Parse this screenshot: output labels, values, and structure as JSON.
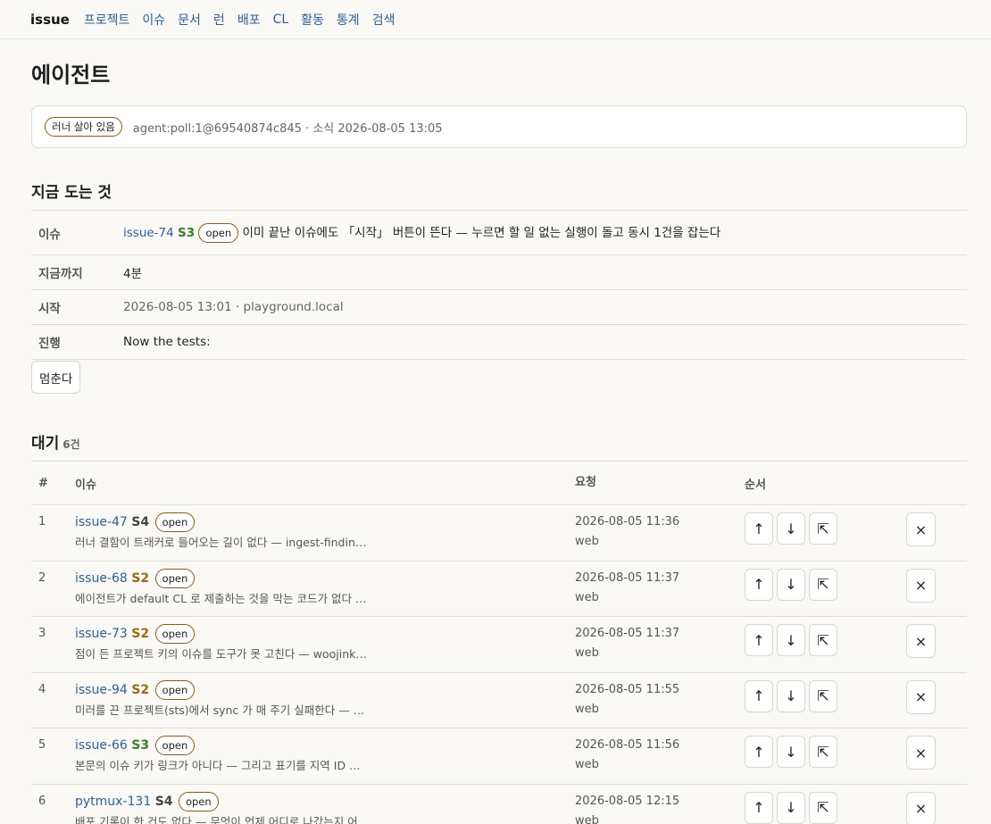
{
  "nav": {
    "brand": "issue",
    "links": [
      "프로젝트",
      "이슈",
      "문서",
      "런",
      "배포",
      "CL",
      "활동",
      "통계",
      "검색"
    ]
  },
  "page_title": "에이전트",
  "runner": {
    "badge": "러너 살아 있음",
    "meta": "agent:poll:1@69540874c845 · 소식 2026-08-05 13:05"
  },
  "now": {
    "heading": "지금 도는 것",
    "rows": {
      "issue": {
        "key": "이슈",
        "issue_id": "issue-74",
        "severity": "S3",
        "status": "open",
        "title": "이미 끝난 이슈에도 「시작」 버튼이 뜬다 — 누르면 할 일 없는 실행이 돌고 동시 1건을 잡는다"
      },
      "elapsed": {
        "key": "지금까지",
        "value": "4분"
      },
      "started": {
        "key": "시작",
        "value": "2026-08-05 13:01 · playground.local"
      },
      "progress": {
        "key": "진행",
        "value": "Now the tests:"
      }
    },
    "stop_label": "멈춘다"
  },
  "queue": {
    "heading": "대기",
    "count": "6건",
    "columns": {
      "num": "#",
      "issue": "이슈",
      "requested": "요청",
      "order": "순서"
    },
    "buttons": {
      "up": "↑",
      "down": "↓",
      "top": "⇱",
      "remove": "×"
    },
    "rows": [
      {
        "num": "1",
        "issue_id": "issue-47",
        "severity": "S4",
        "status": "open",
        "summary": "러너 결함이 트래커로 들어오는 길이 없다 — ingest-findin…",
        "time": "2026-08-05 11:36",
        "source": "web"
      },
      {
        "num": "2",
        "issue_id": "issue-68",
        "severity": "S2",
        "status": "open",
        "summary": "에이전트가 default CL 로 제출하는 것을 막는 코드가 없다 …",
        "time": "2026-08-05 11:37",
        "source": "web"
      },
      {
        "num": "3",
        "issue_id": "issue-73",
        "severity": "S2",
        "status": "open",
        "summary": "점이 든 프로젝트 키의 이슈를 도구가 못 고친다 — woojink…",
        "time": "2026-08-05 11:37",
        "source": "web"
      },
      {
        "num": "4",
        "issue_id": "issue-94",
        "severity": "S2",
        "status": "open",
        "summary": "미러를 끈 프로젝트(sts)에서 sync 가 매 주기 실패한다 — …",
        "time": "2026-08-05 11:55",
        "source": "web"
      },
      {
        "num": "5",
        "issue_id": "issue-66",
        "severity": "S3",
        "status": "open",
        "summary": "본문의 이슈 키가 링크가 아니다 — 그리고 표기를 지역 ID …",
        "time": "2026-08-05 11:56",
        "source": "web"
      },
      {
        "num": "6",
        "issue_id": "pytmux-131",
        "severity": "S4",
        "status": "open",
        "summary": "배포 기록이 한 건도 없다 — 무엇이 언제 어디로 나갔는지 어…",
        "time": "2026-08-05 12:15",
        "source": "web"
      }
    ]
  }
}
